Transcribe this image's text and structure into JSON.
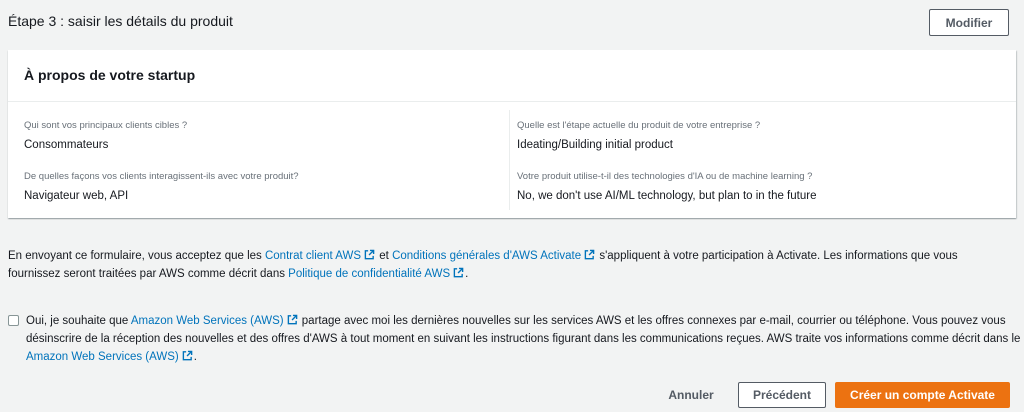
{
  "step": {
    "title": "Étape 3 : saisir les détails du produit",
    "edit_label": "Modifier"
  },
  "card": {
    "title": "À propos de votre startup",
    "fields": [
      {
        "label": "Qui sont vos principaux clients cibles ?",
        "value": "Consommateurs"
      },
      {
        "label": "Quelle est l'étape actuelle du produit de votre entreprise ?",
        "value": "Ideating/Building initial product"
      },
      {
        "label": "De quelles façons vos clients interagissent-ils avec votre produit?",
        "value": "Navigateur web, API"
      },
      {
        "label": "Votre produit utilise-t-il des technologies d'IA ou de machine learning ?",
        "value": "No, we don't use AI/ML technology, but plan to in the future"
      }
    ]
  },
  "legal": {
    "part1": "En envoyant ce formulaire, vous acceptez que les ",
    "link1": "Contrat client AWS",
    "part2": " et ",
    "link2": "Conditions générales d'AWS Activate",
    "part3": " s'appliquent à votre participation à Activate. Les informations que vous fournissez seront traitées par AWS comme décrit dans ",
    "link3": "Politique de confidentialité AWS",
    "part4": "."
  },
  "consent": {
    "part1": "Oui, je souhaite que ",
    "link1": "Amazon Web Services (AWS)",
    "part2": " partage avec moi les dernières nouvelles sur les services AWS et les offres connexes par e-mail, courrier ou téléphone. Vous pouvez vous désinscrire de la réception des nouvelles et des offres d'AWS à tout moment en suivant les instructions figurant dans les communications reçues. AWS traite vos informations comme décrit dans le ",
    "link2": "Amazon Web Services (AWS)",
    "part3": ".",
    "checked": false
  },
  "actions": {
    "cancel_label": "Annuler",
    "previous_label": "Précédent",
    "create_label": "Créer un compte Activate"
  },
  "colors": {
    "link": "#0073bb",
    "primary": "#ec7211",
    "background": "#f2f3f3"
  },
  "icons": {
    "external_link": "external-link-icon"
  }
}
